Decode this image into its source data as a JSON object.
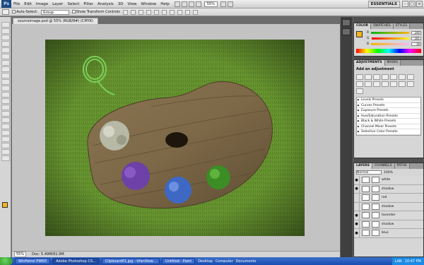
{
  "menubar": {
    "logo": "Ps",
    "items": [
      "File",
      "Edit",
      "Image",
      "Layer",
      "Select",
      "Filter",
      "Analysis",
      "3D",
      "View",
      "Window",
      "Help"
    ],
    "zoom": "55%",
    "workspace": "ESSENTIALS"
  },
  "options": {
    "auto_select_label": "Auto-Select:",
    "auto_select_value": "Group",
    "transform_label": "Show Transform Controls"
  },
  "document": {
    "tab_title": "sourceimage.psd @ 55% (RGB/8#) (CMYK)",
    "status_zoom": "55%",
    "status_doc": "Doc: 5.49M/61.9M"
  },
  "color_panel": {
    "tabs": [
      "COLOR",
      "SWATCHES",
      "STYLES"
    ],
    "rows": [
      {
        "label": "R",
        "value": "246"
      },
      {
        "label": "G",
        "value": "181"
      },
      {
        "label": "B",
        "value": "18"
      }
    ],
    "foreground": "#f2b51c"
  },
  "adjustments_panel": {
    "tabs": [
      "ADJUSTMENTS",
      "MASKS"
    ],
    "title": "Add an adjustment",
    "presets": [
      "Levels Presets",
      "Curves Presets",
      "Exposure Presets",
      "Hue/Saturation Presets",
      "Black & White Presets",
      "Channel Mixer Presets",
      "Selective Color Presets"
    ]
  },
  "layers_panel": {
    "tabs": [
      "LAYERS",
      "CHANNELS",
      "PATHS"
    ],
    "blend_mode": "Normal",
    "opacity": "100%",
    "layers": [
      {
        "name": "white",
        "visible": true
      },
      {
        "name": "shadow",
        "visible": true
      },
      {
        "name": "red",
        "visible": false
      },
      {
        "name": "shadow",
        "visible": false
      },
      {
        "name": "lavender",
        "visible": true
      },
      {
        "name": "shadow",
        "visible": true
      },
      {
        "name": "blue",
        "visible": true
      }
    ]
  },
  "taskbar": {
    "tasks": [
      "WinPatrol PWN3",
      "Adobe Photoshop CS...",
      "Clipboard01.jpg - IrfanView...",
      "Untitled - Paint"
    ],
    "quick": [
      "Desktop",
      "Computer",
      "Documents"
    ],
    "tray": [
      "LAN",
      "10:47 PM"
    ]
  }
}
